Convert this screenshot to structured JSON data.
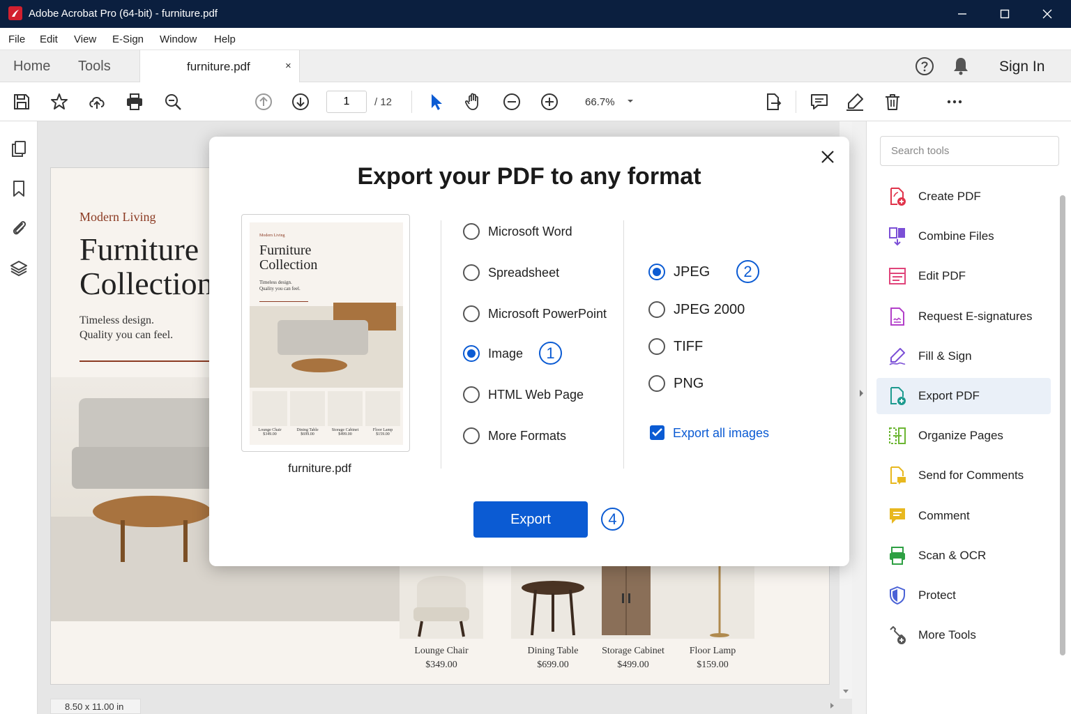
{
  "window": {
    "title": "Adobe Acrobat Pro (64-bit) - furniture.pdf",
    "controls": [
      "minimize-icon",
      "maximize-icon",
      "close-icon"
    ]
  },
  "menu": [
    "File",
    "Edit",
    "View",
    "E-Sign",
    "Window",
    "Help"
  ],
  "tabs": {
    "home": "Home",
    "tools": "Tools",
    "document": "furniture.pdf",
    "close_glyph": "×",
    "sign_in": "Sign In"
  },
  "toolbar": {
    "current_page": "1",
    "total_pages": "/ 12",
    "zoom": "66.7%"
  },
  "document": {
    "brand": "Modern Living",
    "title": "Furniture Collection",
    "tagline_1": "Timeless design.",
    "tagline_2": "Quality you can feel.",
    "page_size": "8.50 x 11.00 in",
    "products": [
      {
        "name": "Lounge Chair",
        "price": "$349.00"
      },
      {
        "name": "Dining Table",
        "price": "$699.00"
      },
      {
        "name": "Storage Cabinet",
        "price": "$499.00"
      },
      {
        "name": "Floor Lamp",
        "price": "$159.00"
      }
    ]
  },
  "modal": {
    "title": "Export your PDF to any format",
    "thumbnail_caption": "furniture.pdf",
    "formats": [
      {
        "label": "Microsoft Word",
        "checked": false
      },
      {
        "label": "Spreadsheet",
        "checked": false
      },
      {
        "label": "Microsoft PowerPoint",
        "checked": false
      },
      {
        "label": "Image",
        "checked": true
      },
      {
        "label": "HTML Web Page",
        "checked": false
      },
      {
        "label": "More Formats",
        "checked": false
      }
    ],
    "image_formats": [
      {
        "label": "JPEG",
        "checked": true
      },
      {
        "label": "JPEG 2000",
        "checked": false
      },
      {
        "label": "TIFF",
        "checked": false
      },
      {
        "label": "PNG",
        "checked": false
      }
    ],
    "export_all_images": {
      "label": "Export all images",
      "checked": true
    },
    "export_button": "Export",
    "step_badges": {
      "image": "1",
      "jpeg": "2",
      "export": "4"
    }
  },
  "tools_panel": {
    "search_placeholder": "Search tools",
    "active": "Export PDF",
    "items": [
      {
        "label": "Create PDF",
        "icon": "create-pdf-icon",
        "color": "#e0344b"
      },
      {
        "label": "Combine Files",
        "icon": "combine-files-icon",
        "color": "#7b4fd6"
      },
      {
        "label": "Edit PDF",
        "icon": "edit-pdf-icon",
        "color": "#e0447a"
      },
      {
        "label": "Request E-signatures",
        "icon": "request-esign-icon",
        "color": "#b23fc9"
      },
      {
        "label": "Fill & Sign",
        "icon": "fill-sign-icon",
        "color": "#7b4fd6"
      },
      {
        "label": "Export PDF",
        "icon": "export-pdf-icon",
        "color": "#1d9a8f"
      },
      {
        "label": "Organize Pages",
        "icon": "organize-pages-icon",
        "color": "#6cb633"
      },
      {
        "label": "Send for Comments",
        "icon": "send-comments-icon",
        "color": "#e8b81f"
      },
      {
        "label": "Comment",
        "icon": "comment-icon",
        "color": "#e8b81f"
      },
      {
        "label": "Scan & OCR",
        "icon": "scan-ocr-icon",
        "color": "#2ea043"
      },
      {
        "label": "Protect",
        "icon": "protect-icon",
        "color": "#4a62d6"
      },
      {
        "label": "More Tools",
        "icon": "more-tools-icon",
        "color": "#555555"
      }
    ]
  },
  "colors": {
    "titlebar": "#0b1f3f",
    "accent": "#0b5bd3",
    "brand_red": "#d2202f"
  }
}
